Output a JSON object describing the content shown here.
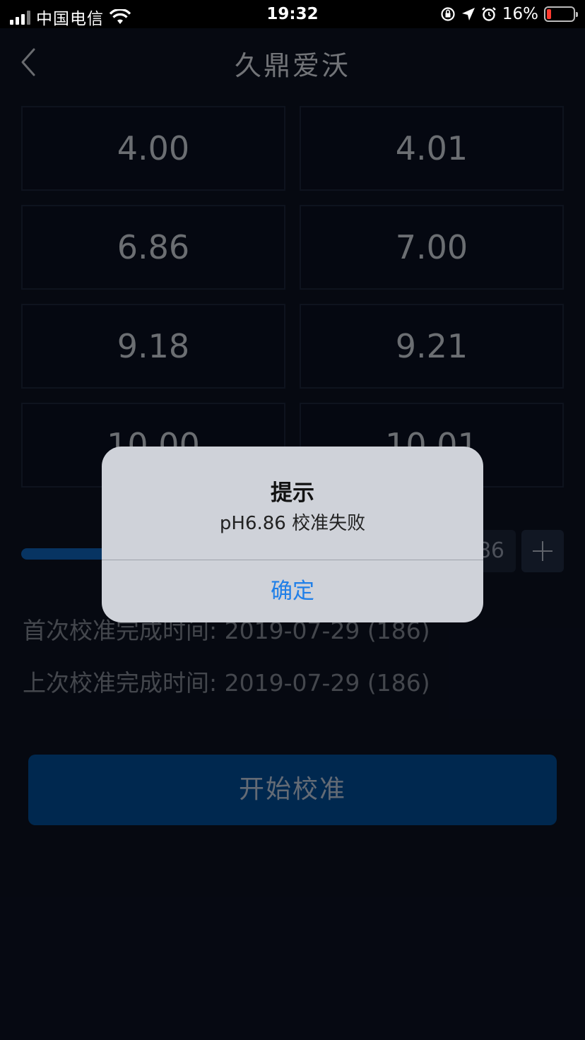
{
  "status_bar": {
    "carrier": "中国电信",
    "time": "19:32",
    "battery_text": "16%"
  },
  "nav": {
    "title": "久鼎爱沃"
  },
  "buffers": [
    {
      "value": "4.00"
    },
    {
      "value": "4.01"
    },
    {
      "value": "6.86"
    },
    {
      "value": "7.00"
    },
    {
      "value": "9.18"
    },
    {
      "value": "9.21"
    },
    {
      "value": "10.00"
    },
    {
      "value": "10.01"
    }
  ],
  "stepper": {
    "value_partial": "86"
  },
  "info": {
    "first_calibration": "首次校准完成时间: 2019-07-29 (186)",
    "last_calibration": "上次校准完成时间: 2019-07-29 (186)"
  },
  "start_button": "开始校准",
  "alert": {
    "title": "提示",
    "message": "pH6.86 校准失败",
    "confirm": "确定"
  },
  "colors": {
    "background": "#0b1120",
    "primary_button": "#004a91",
    "slider_fill": "#0d5fb3",
    "alert_link": "#1f7fe8",
    "battery_low": "#ff3b30"
  }
}
